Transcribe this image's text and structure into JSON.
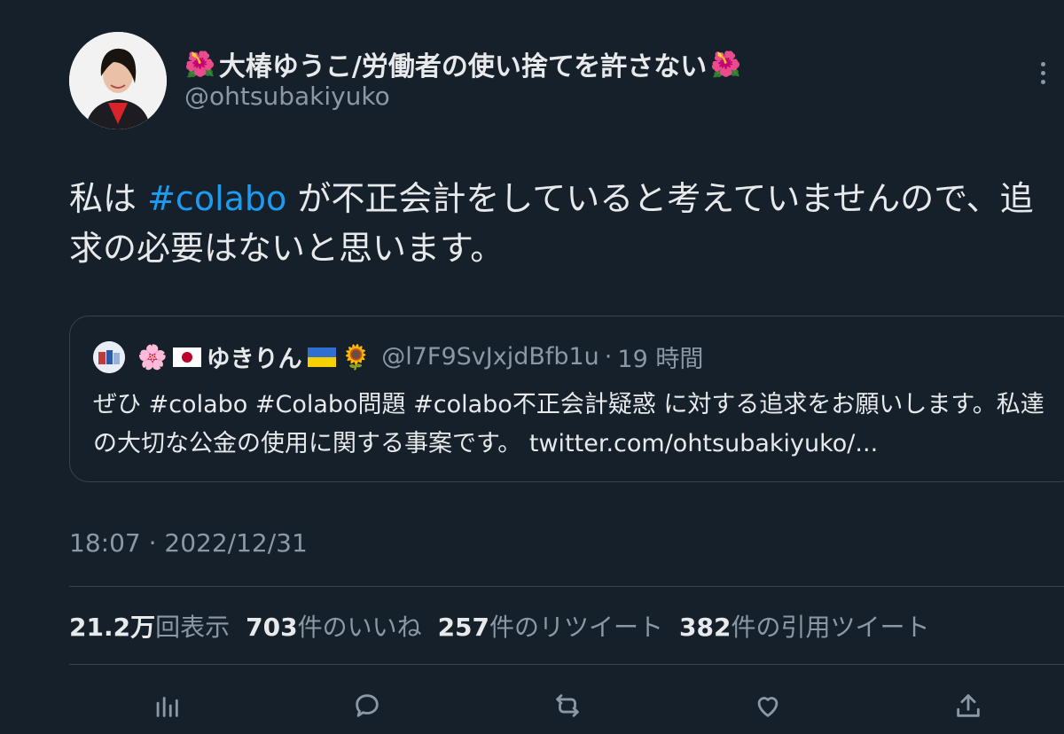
{
  "author": {
    "flower_left": "🌺",
    "name": "大椿ゆうこ/労働者の使い捨てを許さない",
    "flower_right": "🌺",
    "handle": "@ohtsubakiyuko"
  },
  "tweet": {
    "prefix": "私は ",
    "hashtag": "#colabo",
    "rest": " が不正会計をしていると考えていませんので、追求の必要はないと思います。"
  },
  "quote": {
    "emoji_blossom": "🌸",
    "name": "ゆきりん",
    "emoji_sunflower": "🌻",
    "handle": "@l7F9SvJxjdBfb1u",
    "sep": "·",
    "time": "19 時間",
    "text": "ぜひ #colabo #Colabo問題 #colabo不正会計疑惑 に対する追求をお願いします。私達の大切な公金の使用に関する事案です。 twitter.com/ohtsubakiyuko/..."
  },
  "timestamp": "18:07 · 2022/12/31",
  "stats": {
    "views_value": "21.2万",
    "views_label": "回表示",
    "likes_value": "703",
    "likes_label": "件のいいね",
    "retweets_value": "257",
    "retweets_label": "件のリツイート",
    "quotes_value": "382",
    "quotes_label": "件の引用ツイート"
  },
  "actions": {
    "icons": [
      "analytics-icon",
      "reply-icon",
      "retweet-icon",
      "like-icon",
      "share-icon"
    ]
  },
  "colors": {
    "background": "#15202b",
    "accent": "#1d9bf0",
    "secondary_text": "#8b98a5",
    "border": "#38444d"
  }
}
